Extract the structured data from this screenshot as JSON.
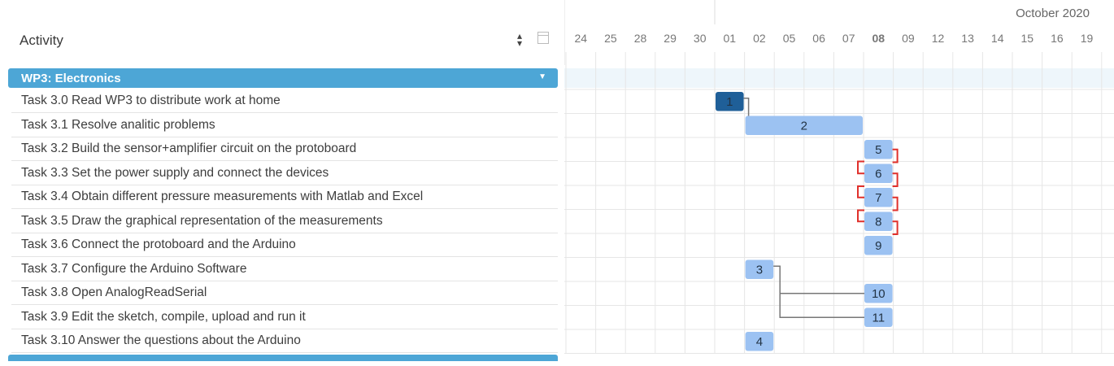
{
  "header": {
    "activity_label": "Activity",
    "month_label": "October 2020"
  },
  "days": [
    "24",
    "25",
    "28",
    "29",
    "30",
    "01",
    "02",
    "05",
    "06",
    "07",
    "08",
    "09",
    "12",
    "13",
    "14",
    "15",
    "16",
    "19"
  ],
  "today_index": 10,
  "group": {
    "label": "WP3: Electronics"
  },
  "tasks": [
    {
      "label": "Task 3.0 Read WP3 to distribute work at home",
      "bar": {
        "num": "1",
        "start": 5,
        "len": 1,
        "style": "dark"
      }
    },
    {
      "label": "Task 3.1 Resolve analitic problems",
      "bar": {
        "num": "2",
        "start": 6,
        "len": 4,
        "style": "light"
      }
    },
    {
      "label": "Task 3.2 Build the sensor+amplifier circuit on the protoboard",
      "bar": {
        "num": "5",
        "start": 10,
        "len": 1,
        "style": "light"
      }
    },
    {
      "label": "Task 3.3 Set the power supply and connect the devices",
      "bar": {
        "num": "6",
        "start": 10,
        "len": 1,
        "style": "light"
      }
    },
    {
      "label": "Task 3.4 Obtain different pressure measurements with Matlab and Excel",
      "bar": {
        "num": "7",
        "start": 10,
        "len": 1,
        "style": "light"
      }
    },
    {
      "label": "Task 3.5 Draw the graphical representation of the measurements",
      "bar": {
        "num": "8",
        "start": 10,
        "len": 1,
        "style": "light"
      }
    },
    {
      "label": "Task 3.6 Connect the protoboard and the Arduino",
      "bar": {
        "num": "9",
        "start": 10,
        "len": 1,
        "style": "light"
      }
    },
    {
      "label": "Task 3.7 Configure the Arduino Software",
      "bar": {
        "num": "3",
        "start": 6,
        "len": 1,
        "style": "light"
      }
    },
    {
      "label": "Task 3.8 Open AnalogReadSerial",
      "bar": {
        "num": "10",
        "start": 10,
        "len": 1,
        "style": "light"
      }
    },
    {
      "label": "Task 3.9 Edit the sketch, compile, upload and run it",
      "bar": {
        "num": "11",
        "start": 10,
        "len": 1,
        "style": "light"
      }
    },
    {
      "label": "Task 3.10 Answer the questions about the Arduino",
      "bar": {
        "num": "4",
        "start": 6,
        "len": 1,
        "style": "light"
      }
    }
  ],
  "colors": {
    "bar_light": "#9cc2f2",
    "bar_dark": "#1f5f98",
    "today": "#2f7fd6",
    "critical_link": "#e0302b",
    "link": "#777777",
    "group": "#4da6d6"
  }
}
